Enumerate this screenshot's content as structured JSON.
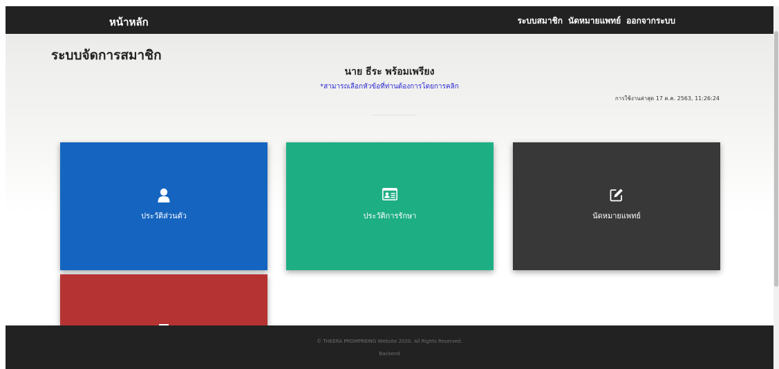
{
  "navbar": {
    "brand": "หน้าหลัก",
    "links": [
      {
        "label": "ระบบสมาชิก"
      },
      {
        "label": "นัดหมายแพทย์"
      },
      {
        "label": "ออกจากระบบ"
      }
    ]
  },
  "main": {
    "title": "ระบบจัดการสมาชิก",
    "member_name": "นาย ธีระ พร้อมเพรียง",
    "hint": "*สามารถเลือกหัวข้อที่ท่านต้องการโดยการคลิก",
    "last_login": "การใช้งานล่าสุด 17 ต.ค. 2563, 11:26:24",
    "cards": [
      {
        "label": "ประวัติส่วนตัว",
        "icon": "user-icon",
        "color": "#1565c0"
      },
      {
        "label": "ประวัติการรักษา",
        "icon": "id-card-icon",
        "color": "#1eae83"
      },
      {
        "label": "นัดหมายแพทย์",
        "icon": "edit-icon",
        "color": "#383838"
      },
      {
        "label": "",
        "icon": "partial-icon",
        "color": "#b63333"
      }
    ]
  },
  "footer": {
    "copyright": "© THEERA PROMPREING Website 2020. All Rights Reserved.",
    "backend": "Backend"
  },
  "colors": {
    "navbar_bg": "#222222",
    "hint_text": "#2a2ad2"
  }
}
